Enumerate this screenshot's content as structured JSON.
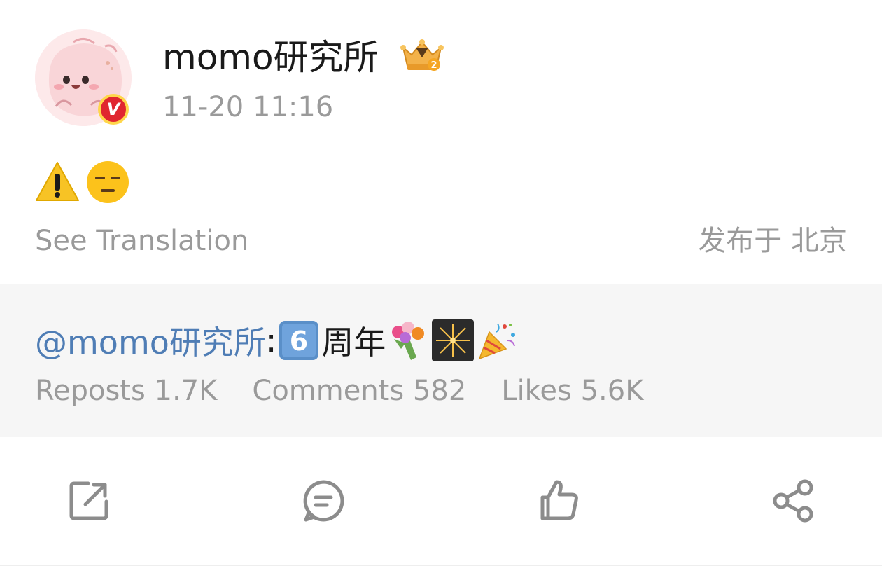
{
  "author": {
    "name": "momo研究所",
    "verified_badge": "V",
    "timestamp": "11-20 11:16",
    "avatar_icon": "pink-blob-avatar",
    "rank_icon": "crown-rank-2-icon"
  },
  "post": {
    "content_icons": [
      "warning-icon",
      "expressionless-face-icon"
    ],
    "translate_label": "See Translation",
    "location": "发布于 北京"
  },
  "repost": {
    "mention": "@momo研究所",
    "separator": ":",
    "keycap_icon": "keycap-6-icon",
    "text": "周年",
    "trailing_icons": [
      "bouquet-icon",
      "sparkler-icon",
      "party-popper-icon"
    ],
    "stats": {
      "reposts": "Reposts 1.7K",
      "comments": "Comments 582",
      "likes": "Likes 5.6K"
    }
  },
  "actions": [
    "repost-icon",
    "comment-icon",
    "like-icon",
    "share-icon"
  ],
  "colors": {
    "mention_blue": "#4f7db5",
    "muted_gray": "#9a9a9a",
    "repost_bg": "#f6f6f6",
    "badge_red": "#e0262f",
    "badge_gold": "#ffd64a"
  }
}
